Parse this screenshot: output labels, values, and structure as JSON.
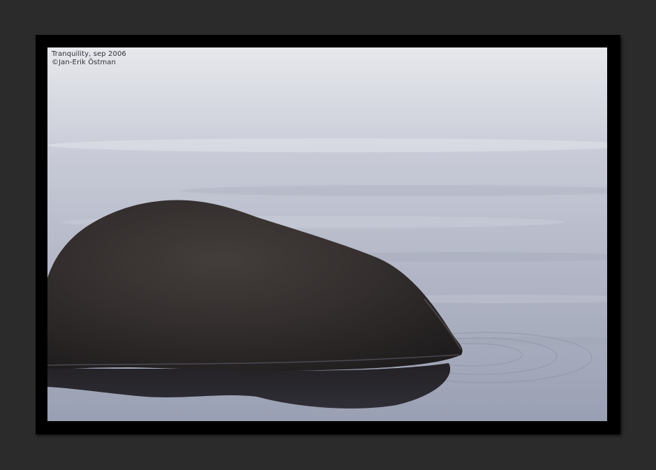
{
  "photo": {
    "caption_title": "Tranquility, sep 2006",
    "caption_credit": "©Jan-Erik Östman",
    "subject": "rock in still water"
  }
}
